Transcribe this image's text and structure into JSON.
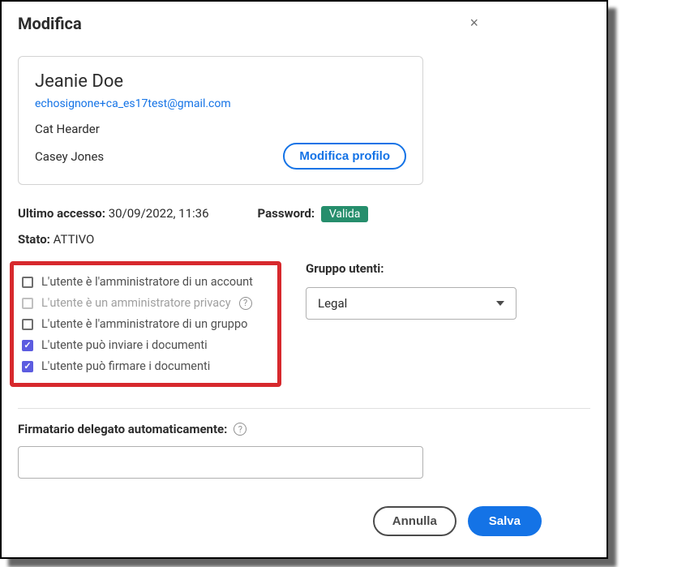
{
  "modal": {
    "title": "Modifica",
    "close_label": "×"
  },
  "profile": {
    "name": "Jeanie Doe",
    "email": "echosignone+ca_es17test@gmail.com",
    "line1": "Cat Hearder",
    "line2": "Casey Jones",
    "edit_button": "Modifica profilo"
  },
  "meta": {
    "last_access_label": "Ultimo accesso:",
    "last_access_value": "30/09/2022, 11:36",
    "password_label": "Password:",
    "password_badge": "Valida",
    "state_label": "Stato:",
    "state_value": "ATTIVO"
  },
  "permissions": {
    "items": [
      {
        "label": "L'utente è l'amministratore di un account",
        "checked": false,
        "disabled": false,
        "help": false
      },
      {
        "label": "L'utente è un amministratore privacy",
        "checked": false,
        "disabled": true,
        "help": true
      },
      {
        "label": "L'utente è l'amministratore di un gruppo",
        "checked": false,
        "disabled": false,
        "help": false
      },
      {
        "label": "L'utente può inviare i documenti",
        "checked": true,
        "disabled": false,
        "help": false
      },
      {
        "label": "L'utente può firmare i documenti",
        "checked": true,
        "disabled": false,
        "help": false
      }
    ]
  },
  "group": {
    "label": "Gruppo utenti:",
    "selected": "Legal"
  },
  "delegate": {
    "label": "Firmatario delegato automaticamente:",
    "value": ""
  },
  "footer": {
    "cancel": "Annulla",
    "save": "Salva"
  }
}
